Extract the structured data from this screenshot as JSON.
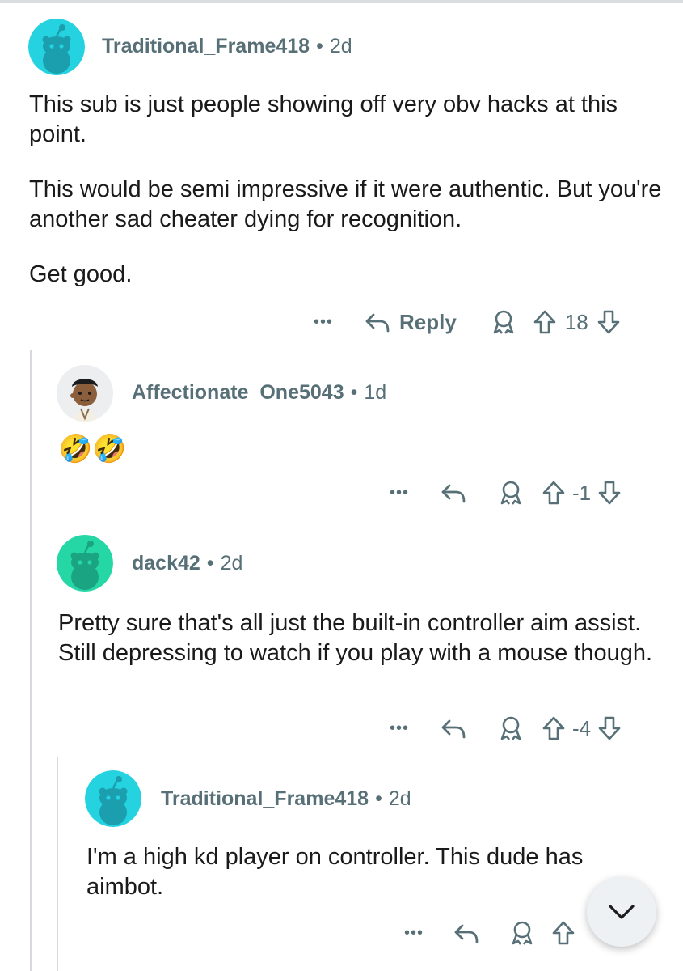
{
  "comments": [
    {
      "username": "Traditional_Frame418",
      "separator": "•",
      "time": "2d",
      "paragraphs": [
        "This sub is just people showing off very obv hacks at this point.",
        "This would be semi impressive if it were authentic. But you're another sad cheater dying for recognition.",
        "Get good."
      ],
      "more_label": "•••",
      "reply_label": "Reply",
      "score": "18",
      "avatar_color": "#24d2e0"
    },
    {
      "username": "Affectionate_One5043",
      "separator": "•",
      "time": "1d",
      "emojis": "🤣🤣",
      "more_label": "•••",
      "score": "-1"
    },
    {
      "username": "dack42",
      "separator": "•",
      "time": "2d",
      "paragraphs": [
        "Pretty sure that's all just the built-in controller aim assist. Still depressing to watch if you play with a mouse though."
      ],
      "more_label": "•••",
      "score": "-4",
      "avatar_color": "#26d7a6"
    },
    {
      "username": "Traditional_Frame418",
      "separator": "•",
      "time": "2d",
      "paragraphs": [
        "I'm a high kd player on controller. This dude has aimbot."
      ],
      "more_label": "•••",
      "avatar_color": "#24d2e0"
    }
  ],
  "icons": {
    "more": "ellipsis-icon",
    "reply": "reply-arrow-icon",
    "award": "award-icon",
    "upvote": "upvote-arrow-icon",
    "downvote": "downvote-arrow-icon",
    "scroll": "chevron-down-icon"
  }
}
